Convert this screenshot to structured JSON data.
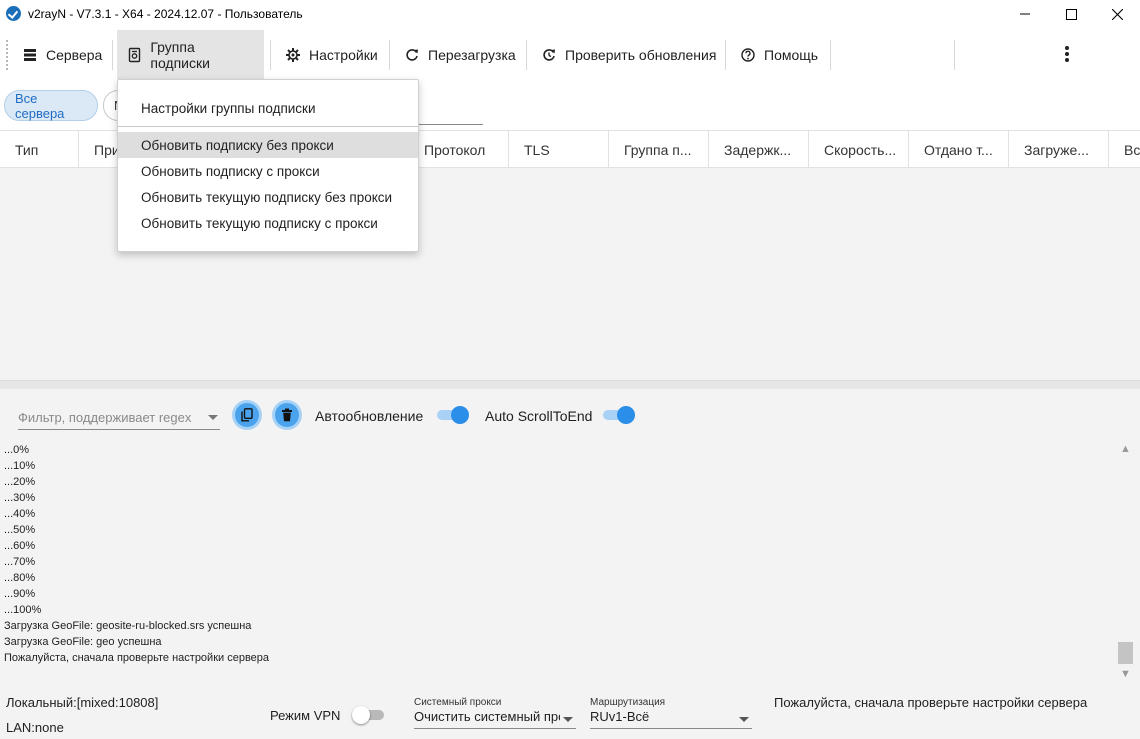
{
  "window": {
    "title": "v2rayN - V7.3.1 - X64 - 2024.12.07 - Пользователь"
  },
  "toolbar": {
    "servers": "Сервера",
    "subscription_group": "Группа подписки",
    "settings": "Настройки",
    "reload": "Перезагрузка",
    "check_updates": "Проверить обновления",
    "help": "Помощь"
  },
  "chips": {
    "all_servers": "Все сервера",
    "second": "N"
  },
  "table": {
    "columns": [
      "Тип",
      "При",
      "Протокол",
      "TLS",
      "Группа п...",
      "Задержк...",
      "Скорость...",
      "Отдано т...",
      "Загруже...",
      "Вс"
    ]
  },
  "dropdown_menu": {
    "items": [
      "Настройки группы подписки",
      "Обновить подписку без прокси",
      "Обновить подписку с прокси",
      "Обновить текущую подписку без прокси",
      "Обновить текущую подписку с прокси"
    ],
    "highlighted_index": 1
  },
  "log_panel": {
    "filter_placeholder": "Фильтр, поддерживает regex",
    "auto_refresh_label": "Автообновление",
    "auto_refresh_on": true,
    "auto_scroll_label": "Auto ScrollToEnd",
    "auto_scroll_on": true,
    "lines": [
      "...0%",
      "...10%",
      "...20%",
      "...30%",
      "...40%",
      "...50%",
      "...60%",
      "...70%",
      "...80%",
      "...90%",
      "...100%",
      "Загрузка GeoFile: geosite-ru-blocked.srs успешна",
      "Загрузка GeoFile: geo успешна",
      "Пожалуйста, сначала проверьте настройки сервера"
    ]
  },
  "statusbar": {
    "local": "Локальный:[mixed:10808]",
    "lan": "LAN:none",
    "vpn_mode_label": "Режим VPN",
    "vpn_mode_on": false,
    "system_proxy_caption": "Системный прокси",
    "system_proxy_value": "Очистить системный прокси",
    "routing_caption": "Маршрутизация",
    "routing_value": "RUv1-Всё",
    "message": "Пожалуйста, сначала проверьте настройки сервера"
  },
  "colors": {
    "accent": "#2b8ee8",
    "chip_bg": "#dbe9f7",
    "chip_text": "#1e6cc2",
    "panel_bg": "#f3f3f3"
  }
}
